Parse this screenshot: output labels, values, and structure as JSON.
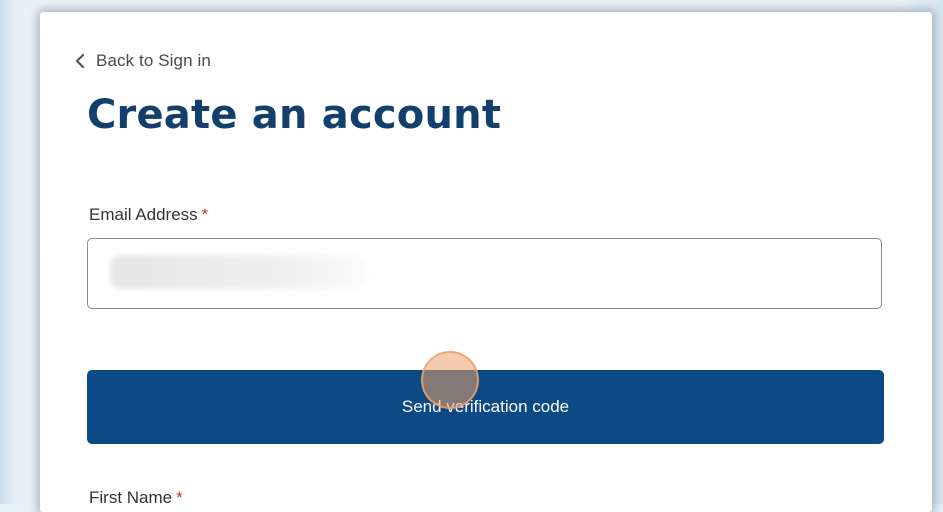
{
  "nav": {
    "back_label": "Back to Sign in"
  },
  "page": {
    "title": "Create an account"
  },
  "form": {
    "email": {
      "label": "Email Address",
      "required_marker": "*",
      "value": ""
    },
    "send_code_button": "Send verification code",
    "first_name": {
      "label": "First Name",
      "required_marker": "*"
    }
  },
  "colors": {
    "title": "#123f6b",
    "button": "#0b4a85",
    "required": "#c0392b"
  },
  "icons": {
    "back": "chevron-left-icon"
  }
}
